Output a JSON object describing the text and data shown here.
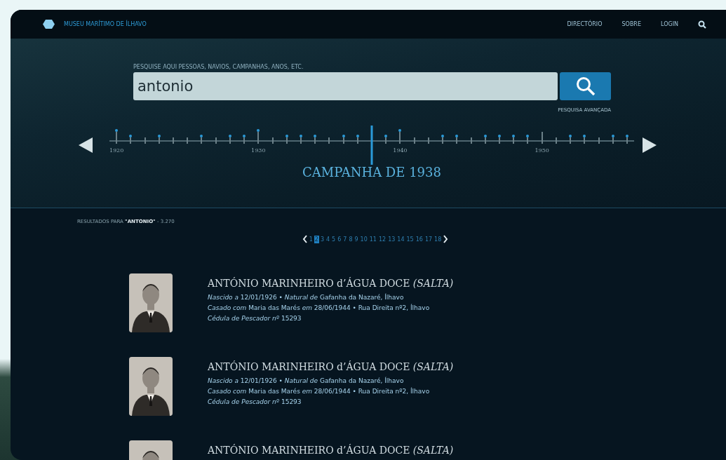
{
  "header": {
    "site_title": "MUSEU MARÍTIMO DE ÍLHAVO",
    "nav": [
      "DIRECTÓRIO",
      "SOBRE",
      "LOGIN"
    ]
  },
  "search": {
    "label": "PESQUISE AQUI PESSOAS, NAVIOS, CAMPANHAS, ANOS, ETC.",
    "value": "antonio",
    "advanced_link": "PESQUISA AVANÇADA"
  },
  "timeline": {
    "ticks": [
      {
        "label": "1920",
        "campaign": true,
        "selected": false
      },
      {
        "campaign": true,
        "selected": false
      },
      {
        "campaign": false,
        "selected": false
      },
      {
        "campaign": true,
        "selected": false
      },
      {
        "campaign": false,
        "selected": false
      },
      {
        "campaign": false,
        "selected": false
      },
      {
        "campaign": true,
        "selected": false
      },
      {
        "campaign": false,
        "selected": false
      },
      {
        "campaign": true,
        "selected": false
      },
      {
        "campaign": true,
        "selected": false
      },
      {
        "label": "1930",
        "campaign": true,
        "selected": false
      },
      {
        "campaign": false,
        "selected": false
      },
      {
        "campaign": true,
        "selected": false
      },
      {
        "campaign": true,
        "selected": false
      },
      {
        "campaign": true,
        "selected": false
      },
      {
        "campaign": false,
        "selected": false
      },
      {
        "campaign": true,
        "selected": false
      },
      {
        "campaign": true,
        "selected": false
      },
      {
        "campaign": false,
        "selected": true
      },
      {
        "campaign": true,
        "selected": false
      },
      {
        "label": "1940",
        "campaign": true,
        "selected": false
      },
      {
        "campaign": false,
        "selected": false
      },
      {
        "campaign": false,
        "selected": false
      },
      {
        "campaign": true,
        "selected": false
      },
      {
        "campaign": true,
        "selected": false
      },
      {
        "campaign": false,
        "selected": false
      },
      {
        "campaign": true,
        "selected": false
      },
      {
        "campaign": true,
        "selected": false
      },
      {
        "campaign": true,
        "selected": false
      },
      {
        "campaign": true,
        "selected": false
      },
      {
        "label": "1950",
        "campaign": false,
        "selected": false
      },
      {
        "campaign": false,
        "selected": false
      },
      {
        "campaign": true,
        "selected": false
      },
      {
        "campaign": true,
        "selected": false
      },
      {
        "campaign": false,
        "selected": false
      },
      {
        "campaign": true,
        "selected": false
      },
      {
        "campaign": true,
        "selected": false
      }
    ],
    "caption": "CAMPANHA DE 1938"
  },
  "results_summary": "RESULTADOS PARA **\"ANTONIO\"** - 3.270",
  "pages": [
    {
      "label": "1",
      "selected": false
    },
    {
      "label": "2",
      "selected": true
    },
    {
      "label": "3",
      "selected": false
    },
    {
      "label": "4",
      "selected": false
    },
    {
      "label": "5",
      "selected": false
    },
    {
      "label": "6",
      "selected": false
    },
    {
      "label": "7",
      "selected": false
    },
    {
      "label": "8",
      "selected": false
    },
    {
      "label": "9",
      "selected": false
    },
    {
      "label": "10",
      "selected": false
    },
    {
      "label": "11",
      "selected": false
    },
    {
      "label": "12",
      "selected": false
    },
    {
      "label": "13",
      "selected": false
    },
    {
      "label": "14",
      "selected": false
    },
    {
      "label": "15",
      "selected": false
    },
    {
      "label": "16",
      "selected": false
    },
    {
      "label": "17",
      "selected": false
    },
    {
      "label": "18",
      "selected": false
    }
  ],
  "results": [
    {
      "name": "ANTÓNIO MARINHEIRO d’ÁGUA DOCE *(SALTA)*",
      "details": [
        "*Nascido a* 12/01/1926  •  *Natural de* Gafanha da Nazaré, Ílhavo",
        "*Casado com* Maria das Marés *em* 28/06/1944  •  Rua Direita nº2, Ílhavo",
        "*Cédula de Pescador nº* 15293"
      ]
    },
    {
      "name": "ANTÓNIO MARINHEIRO d’ÁGUA DOCE *(SALTA)*",
      "details": [
        "*Nascido a* 12/01/1926  •  *Natural de* Gafanha da Nazaré, Ílhavo",
        "*Casado com* Maria das Marés *em* 28/06/1944  •  Rua Direita nº2, Ílhavo",
        "*Cédula de Pescador nº* 15293"
      ]
    },
    {
      "name": "ANTÓNIO MARINHEIRO d’ÁGUA DOCE *(SALTA)*"
    }
  ]
}
